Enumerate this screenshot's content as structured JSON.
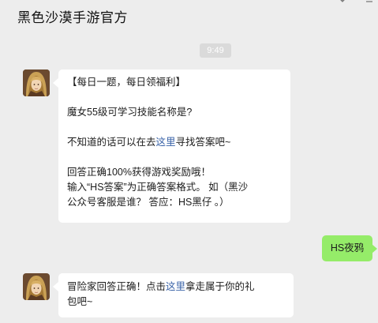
{
  "header": {
    "title": "黑色沙漠手游官方"
  },
  "timestamp": "9:49",
  "messages": [
    {
      "sender": "official",
      "lines": {
        "l1": "【每日一题，每日领福利】",
        "l2": "魔女55级可学习技能名称是?",
        "l3_before": "不知道的话可以在去",
        "l3_link": "这里",
        "l3_after": "寻找答案吧~",
        "l4": "回答正确100%获得游戏奖励哦！",
        "l5": "输入“HS答案”为正确答案格式。 如（黑沙",
        "l6": "公众号客服是谁？ 答应：HS黑仔 。）"
      }
    },
    {
      "sender": "user",
      "text": "HS夜鸦"
    },
    {
      "sender": "official",
      "lines": {
        "l1_before": "冒险家回答正确！点击",
        "l1_link": "这里",
        "l1_after": "拿走属于你的礼",
        "l2": "包吧~"
      }
    }
  ],
  "colors": {
    "background": "#ededed",
    "bubble": "#ffffff",
    "user_bubble": "#95ec69",
    "link": "#3a63a8"
  }
}
